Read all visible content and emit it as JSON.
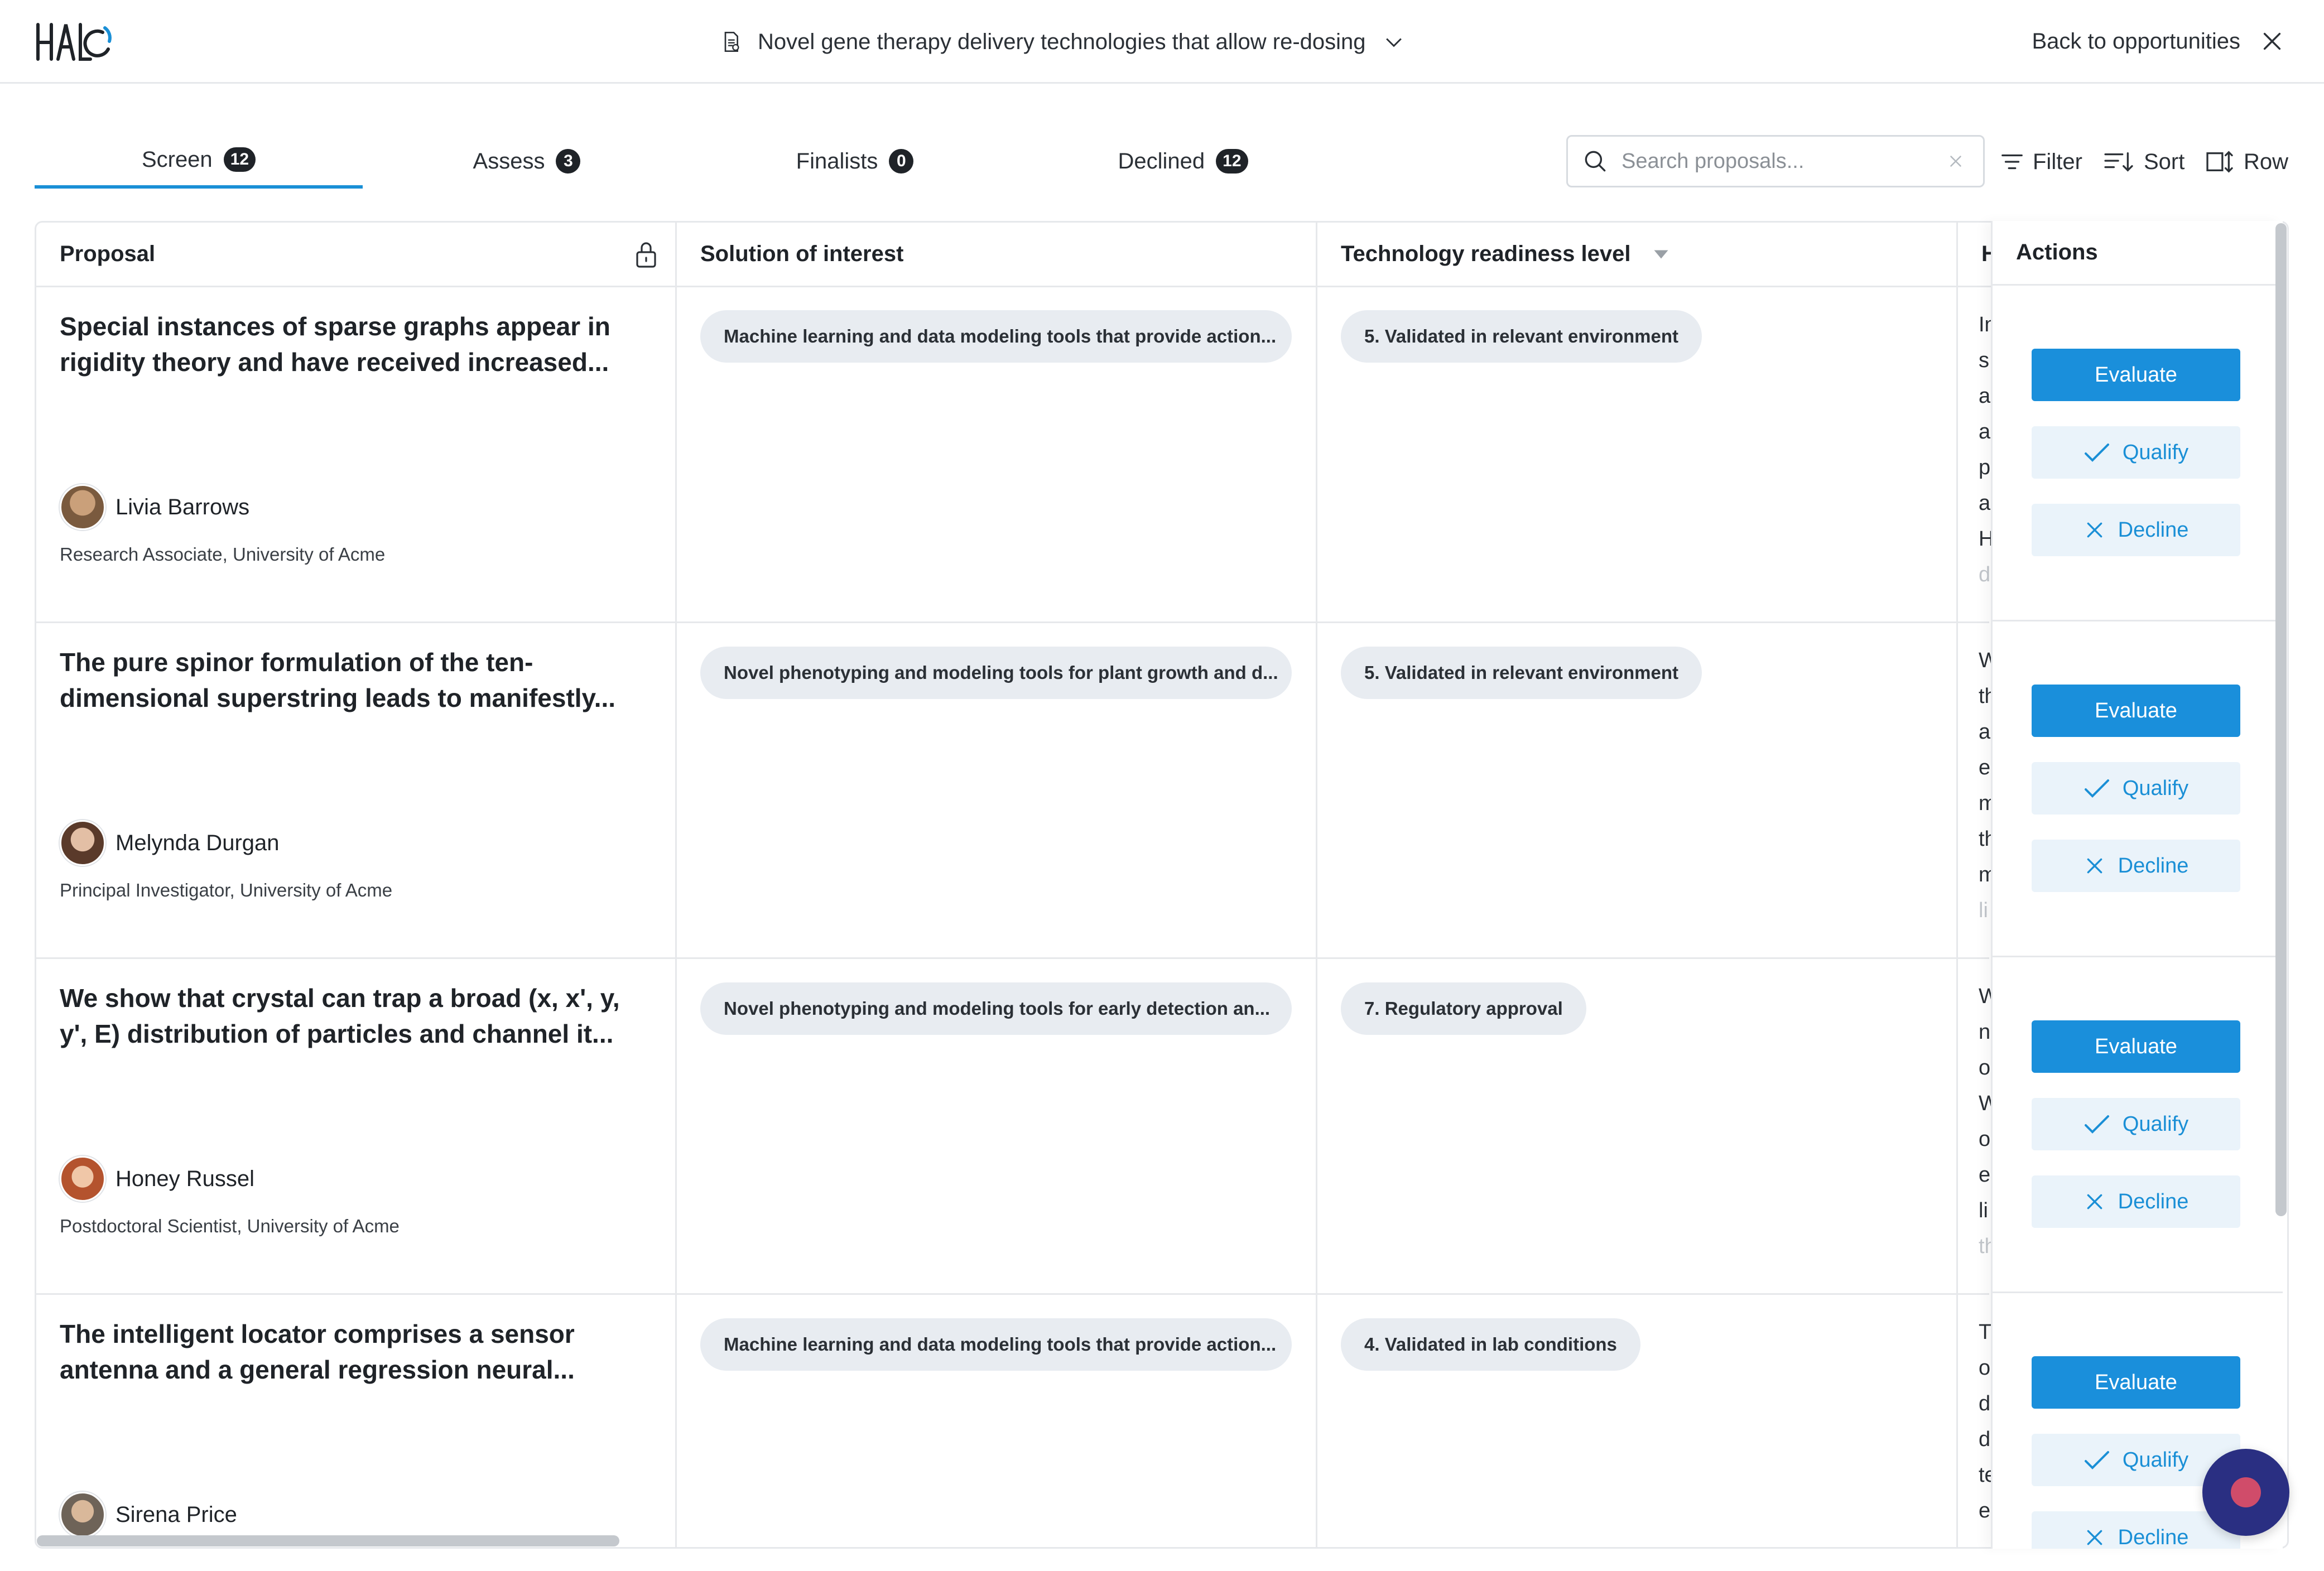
{
  "header": {
    "logo_text": "HALO",
    "opportunity_title": "Novel gene therapy delivery technologies that allow re-dosing",
    "back_label": "Back to opportunities"
  },
  "tabs": [
    {
      "label": "Screen",
      "count": "12",
      "active": true
    },
    {
      "label": "Assess",
      "count": "3",
      "active": false
    },
    {
      "label": "Finalists",
      "count": "0",
      "active": false
    },
    {
      "label": "Declined",
      "count": "12",
      "active": false
    }
  ],
  "toolbar": {
    "search_placeholder": "Search proposals...",
    "filter_label": "Filter",
    "sort_label": "Sort",
    "row_label": "Row"
  },
  "table": {
    "columns": {
      "proposal": "Proposal",
      "solution": "Solution of interest",
      "trl": "Technology readiness level",
      "clipped": "H",
      "actions": "Actions"
    },
    "rows": [
      {
        "title": "Special instances of sparse graphs appear in rigidity theory and have received increased...",
        "person": "Livia Barrows",
        "role": "Research Associate, University of Acme",
        "solution": "Machine learning and data modeling tools that provide action...",
        "trl": "5. Validated in relevant environment",
        "clipped_lines": [
          "In",
          "s",
          "a",
          "a",
          "p",
          "a",
          "H",
          "d"
        ]
      },
      {
        "title": "The pure spinor formulation of the ten-dimensional superstring leads to manifestly...",
        "person": "Melynda Durgan",
        "role": "Principal Investigator, University of Acme",
        "solution": "Novel phenotyping and modeling tools for plant growth and d...",
        "trl": "5. Validated in relevant environment",
        "clipped_lines": [
          "W",
          "th",
          "a",
          "e",
          "m",
          "th",
          "m",
          "li"
        ]
      },
      {
        "title": "We show that crystal can trap a broad (x, x', y, y', E) distribution of particles and channel it...",
        "person": "Honey Russel",
        "role": "Postdoctoral Scientist, University of Acme",
        "solution": "Novel phenotyping and modeling tools for early detection an...",
        "trl": "7. Regulatory approval",
        "clipped_lines": [
          "W",
          "n",
          "o",
          "W",
          "o",
          "e",
          "li",
          "th"
        ]
      },
      {
        "title": "The intelligent locator comprises a sensor antenna and a general regression neural...",
        "person": "Sirena Price",
        "role": "",
        "solution": "Machine learning and data modeling tools that provide action...",
        "trl": "4. Validated in lab conditions",
        "clipped_lines": [
          "T",
          "o",
          "d",
          "d",
          "te",
          "e"
        ]
      }
    ]
  },
  "actions": {
    "evaluate": "Evaluate",
    "qualify": "Qualify",
    "decline": "Decline"
  },
  "colors": {
    "accent": "#1a8fdb",
    "soft_button_bg": "#eaf3fa",
    "chip_bg": "#e8ecf1",
    "chat_bubble": "#2a2f82"
  }
}
